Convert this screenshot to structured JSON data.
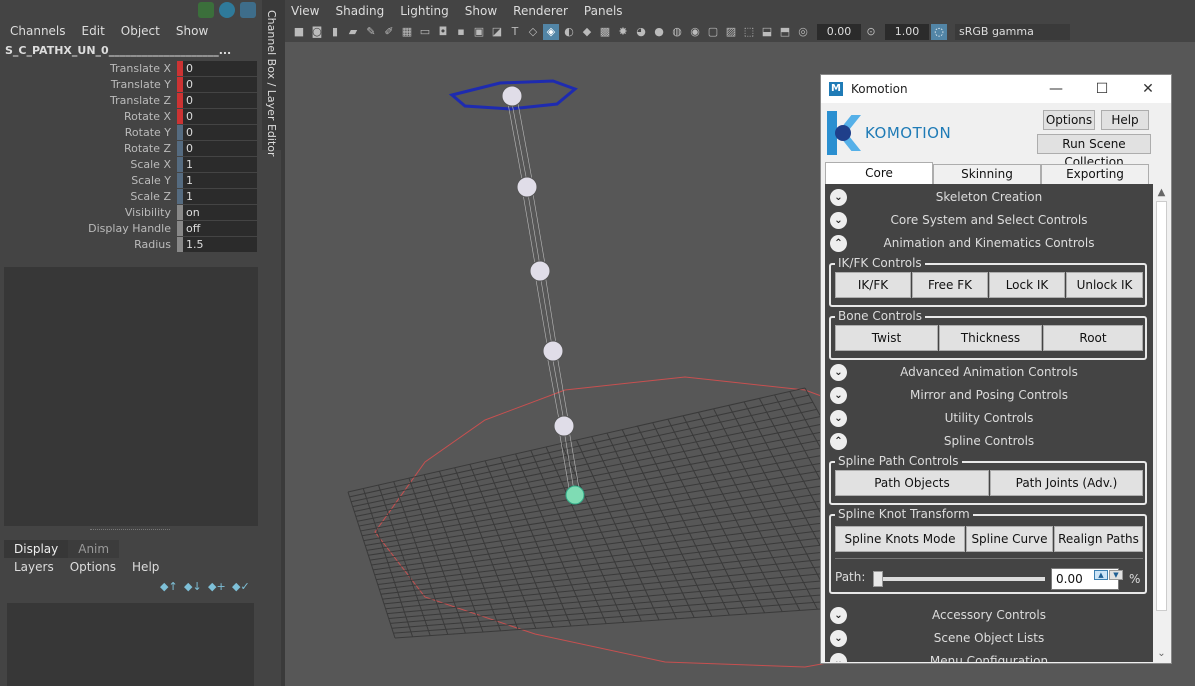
{
  "channel_box": {
    "menu": [
      "Channels",
      "Edit",
      "Object",
      "Show"
    ],
    "object_name": "S_C_PATHX_UN_0____________________...",
    "attributes": [
      {
        "label": "Translate X",
        "value": "0",
        "marker": "#c33"
      },
      {
        "label": "Translate Y",
        "value": "0",
        "marker": "#c33"
      },
      {
        "label": "Translate Z",
        "value": "0",
        "marker": "#c33"
      },
      {
        "label": "Rotate X",
        "value": "0",
        "marker": "#c33"
      },
      {
        "label": "Rotate Y",
        "value": "0",
        "marker": "#556b80"
      },
      {
        "label": "Rotate Z",
        "value": "0",
        "marker": "#556b80"
      },
      {
        "label": "Scale X",
        "value": "1",
        "marker": "#556b80"
      },
      {
        "label": "Scale Y",
        "value": "1",
        "marker": "#556b80"
      },
      {
        "label": "Scale Z",
        "value": "1",
        "marker": "#556b80"
      },
      {
        "label": "Visibility",
        "value": "on",
        "marker": "#888"
      },
      {
        "label": "Display Handle",
        "value": "off",
        "marker": "#888"
      },
      {
        "label": "Radius",
        "value": "1.5",
        "marker": "#888"
      }
    ],
    "side_tab": "Channel Box / Layer Editor"
  },
  "layer_editor": {
    "tabs": [
      "Display",
      "Anim"
    ],
    "menu": [
      "Layers",
      "Options",
      "Help"
    ]
  },
  "viewport": {
    "menu": [
      "View",
      "Shading",
      "Lighting",
      "Show",
      "Renderer",
      "Panels"
    ],
    "exposure": "0.00",
    "gamma": "1.00",
    "color_space": "sRGB gamma"
  },
  "komotion": {
    "window_title": "Komotion",
    "brand": "KOMOTION",
    "options_label": "Options",
    "help_label": "Help",
    "run_scene_label": "Run Scene Collection",
    "tabs": [
      "Core",
      "Skinning",
      "Exporting"
    ],
    "sections_top": [
      {
        "label": "Skeleton Creation",
        "expanded": false
      },
      {
        "label": "Core System and Select Controls",
        "expanded": false
      },
      {
        "label": "Animation and Kinematics Controls",
        "expanded": true
      }
    ],
    "ikfk_group": {
      "title": "IK/FK Controls",
      "buttons": [
        "IK/FK",
        "Free FK",
        "Lock IK",
        "Unlock IK"
      ]
    },
    "bone_group": {
      "title": "Bone Controls",
      "buttons": [
        "Twist",
        "Thickness",
        "Root"
      ]
    },
    "sections_mid": [
      {
        "label": "Advanced Animation Controls",
        "expanded": false
      },
      {
        "label": "Mirror and Posing Controls",
        "expanded": false
      },
      {
        "label": "Utility Controls",
        "expanded": false
      },
      {
        "label": "Spline Controls",
        "expanded": true
      }
    ],
    "spline_path_group": {
      "title": "Spline Path Controls",
      "buttons": [
        "Path Objects",
        "Path Joints (Adv.)"
      ]
    },
    "knot_group": {
      "title": "Spline Knot Transform",
      "buttons": [
        "Spline Knots Mode",
        "Spline Curve",
        "Realign Paths"
      ],
      "path_label": "Path:",
      "path_value": "0.00",
      "path_unit": "%"
    },
    "sections_bottom": [
      {
        "label": "Accessory Controls",
        "expanded": false
      },
      {
        "label": "Scene Object Lists",
        "expanded": false
      },
      {
        "label": "Menu Configuration",
        "expanded": false
      }
    ]
  }
}
